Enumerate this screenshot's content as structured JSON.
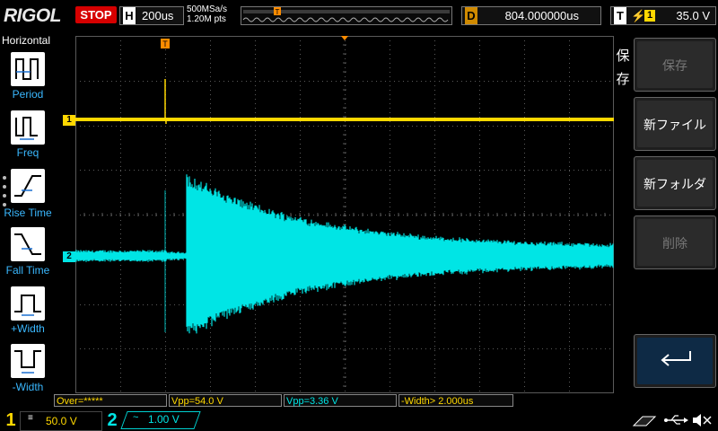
{
  "top": {
    "logo": "RIGOL",
    "run_state": "STOP",
    "timebase_label": "H",
    "timebase_value": "200us",
    "sample_rate": "500MSa/s",
    "memory_depth": "1.20M pts",
    "trigger_marker": "T",
    "delay_label": "D",
    "delay_value": "804.000000us",
    "trigger_label": "T",
    "trigger_source": "1",
    "trigger_level": "35.0 V"
  },
  "left": {
    "title": "Horizontal",
    "items": [
      {
        "label": "Period",
        "icon": "period-icon"
      },
      {
        "label": "Freq",
        "icon": "frequency-icon"
      },
      {
        "label": "Rise Time",
        "icon": "rise-time-icon"
      },
      {
        "label": "Fall Time",
        "icon": "fall-time-icon"
      },
      {
        "label": "+Width",
        "icon": "positive-width-icon"
      },
      {
        "label": "-Width",
        "icon": "negative-width-icon"
      }
    ]
  },
  "screen": {
    "ch1_marker": "1",
    "ch2_marker": "2",
    "trigger_marker": "T",
    "ch1_color": "#ffd800",
    "ch2_color": "#00e5e5",
    "grid_color": "#5a5a5a"
  },
  "right": {
    "tab_label_1": "保",
    "tab_label_2": "存",
    "buttons": [
      {
        "label": "保存",
        "enabled": false
      },
      {
        "label": "新ファイル",
        "enabled": true
      },
      {
        "label": "新フォルダ",
        "enabled": true
      },
      {
        "label": "削除",
        "enabled": false
      }
    ],
    "back_icon": "return-arrow-icon"
  },
  "measurements": {
    "m1": "Over=*****",
    "m2": "Vpp=54.0 V",
    "m3": "Vpp=3.36 V",
    "m4": "-Width> 2.000us"
  },
  "bottom": {
    "ch1_num": "1",
    "ch1_coupling": "≡",
    "ch1_scale": "50.0 V",
    "ch2_num": "2",
    "ch2_coupling": "~",
    "ch2_scale": "1.00 V",
    "icons": [
      "probe-icon",
      "usb-icon",
      "mute-icon"
    ]
  }
}
